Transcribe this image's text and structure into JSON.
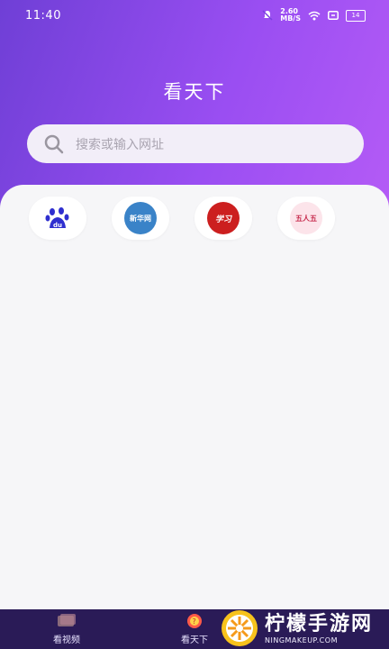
{
  "status_bar": {
    "time": "11:40",
    "speed_value": "2.60",
    "speed_unit": "MB/S",
    "battery": "14"
  },
  "header": {
    "title": "看天下"
  },
  "search": {
    "placeholder": "搜索或输入网址"
  },
  "sites": [
    {
      "name": "du"
    },
    {
      "name": "新华网"
    },
    {
      "name": "学习"
    },
    {
      "name": "五人五"
    }
  ],
  "tabbar": {
    "tabs": [
      {
        "label": "看视频"
      },
      {
        "label": "看天下"
      }
    ]
  },
  "watermark": {
    "big": "柠檬手游网",
    "small": "NINGMAKEUP.COM"
  },
  "colors": {
    "header_start": "#6f3fd6",
    "header_end": "#b65cf6",
    "tabbar": "#2a1b57",
    "card": "#f6f6f8"
  }
}
